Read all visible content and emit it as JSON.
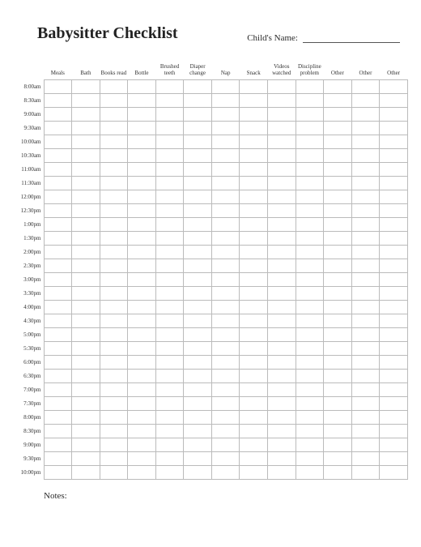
{
  "header": {
    "title": "Babysitter Checklist",
    "name_label": "Child's Name:"
  },
  "columns": [
    "Meals",
    "Bath",
    "Books read",
    "Bottle",
    "Brushed teeth",
    "Diaper change",
    "Nap",
    "Snack",
    "Videos watched",
    "Discipline problem",
    "Other",
    "Other",
    "Other"
  ],
  "times": [
    "8:00am",
    "8:30am",
    "9:00am",
    "9:30am",
    "10:00am",
    "10:30am",
    "11:00am",
    "11:30am",
    "12:00pm",
    "12:30pm",
    "1:00pm",
    "1:30pm",
    "2:00pm",
    "2:30pm",
    "3:00pm",
    "3:30pm",
    "4:00pm",
    "4:30pm",
    "5:00pm",
    "5:30pm",
    "6:00pm",
    "6:30pm",
    "7:00pm",
    "7:30pm",
    "8:00pm",
    "8:30pm",
    "9:00pm",
    "9:30pm",
    "10:00pm"
  ],
  "notes_label": "Notes:"
}
